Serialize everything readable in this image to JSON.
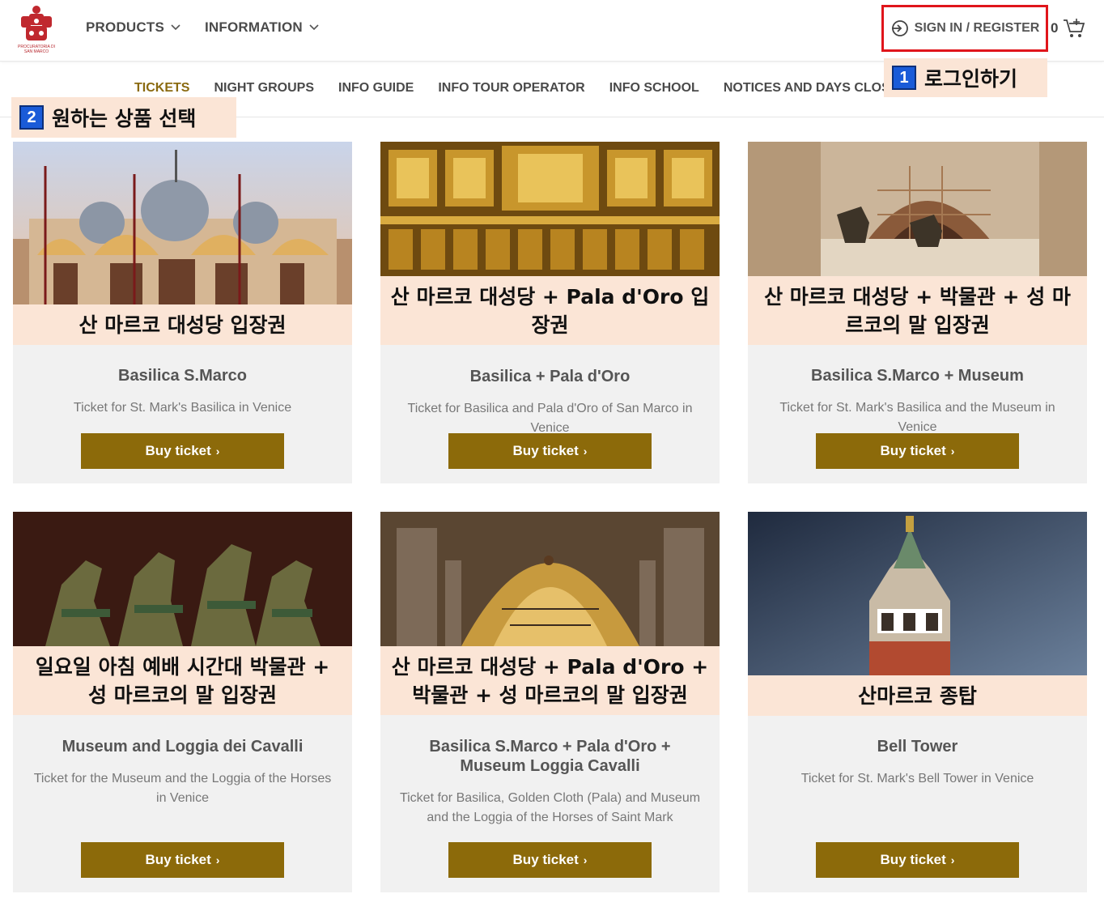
{
  "header": {
    "logo_text": "PROCURATORIA DI SAN MARCO",
    "nav": [
      {
        "label": "PRODUCTS"
      },
      {
        "label": "INFORMATION"
      }
    ],
    "signin_label": "SIGN IN / REGISTER",
    "cart_count": "0"
  },
  "subnav": [
    {
      "label": "TICKETS",
      "active": true
    },
    {
      "label": "NIGHT GROUPS"
    },
    {
      "label": "INFO GUIDE"
    },
    {
      "label": "INFO TOUR OPERATOR"
    },
    {
      "label": "INFO SCHOOL"
    },
    {
      "label": "NOTICES AND DAYS CLOSURE BASILICA"
    }
  ],
  "annotations": {
    "a1": {
      "num": "1",
      "text": "로그인하기"
    },
    "a2": {
      "num": "2",
      "text": "원하는 상품 선택"
    }
  },
  "cards": [
    {
      "overlay": "산 마르코 대성당 입장권",
      "title": "Basilica S.Marco",
      "desc": "Ticket for St. Mark's Basilica in Venice",
      "button": "Buy ticket"
    },
    {
      "overlay": "산 마르코 대성당 + Pala d'Oro 입장권",
      "title": "Basilica + Pala d'Oro",
      "desc": "Ticket for Basilica and Pala d'Oro of San Marco in Venice",
      "button": "Buy ticket"
    },
    {
      "overlay": "산 마르코 대성당 + 박물관 + 성 마르코의 말 입장권",
      "title": "Basilica S.Marco + Museum",
      "desc": "Ticket for St. Mark's Basilica and the Museum in Venice",
      "button": "Buy ticket"
    },
    {
      "overlay": "일요일 아침 예배 시간대 박물관 + 성 마르코의 말 입장권",
      "title": "Museum and Loggia dei Cavalli",
      "desc": "Ticket for the Museum and the Loggia of the Horses in Venice",
      "button": "Buy ticket"
    },
    {
      "overlay": "산 마르코 대성당 + Pala d'Oro + 박물관 + 성 마르코의 말 입장권",
      "title": "Basilica S.Marco + Pala d'Oro + Museum Loggia Cavalli",
      "desc": "Ticket for Basilica, Golden Cloth (Pala) and Museum and the Loggia of the Horses of Saint Mark",
      "button": "Buy ticket"
    },
    {
      "overlay": "산마르코 종탑",
      "title": "Bell Tower",
      "desc": "Ticket for St. Mark's Bell Tower in Venice",
      "button": "Buy ticket"
    }
  ],
  "colors": {
    "accent": "#8c6a0a",
    "annotation_bg": "#fbe5d6",
    "highlight_border": "#e0151b",
    "badge_blue": "#1a5bd8"
  }
}
